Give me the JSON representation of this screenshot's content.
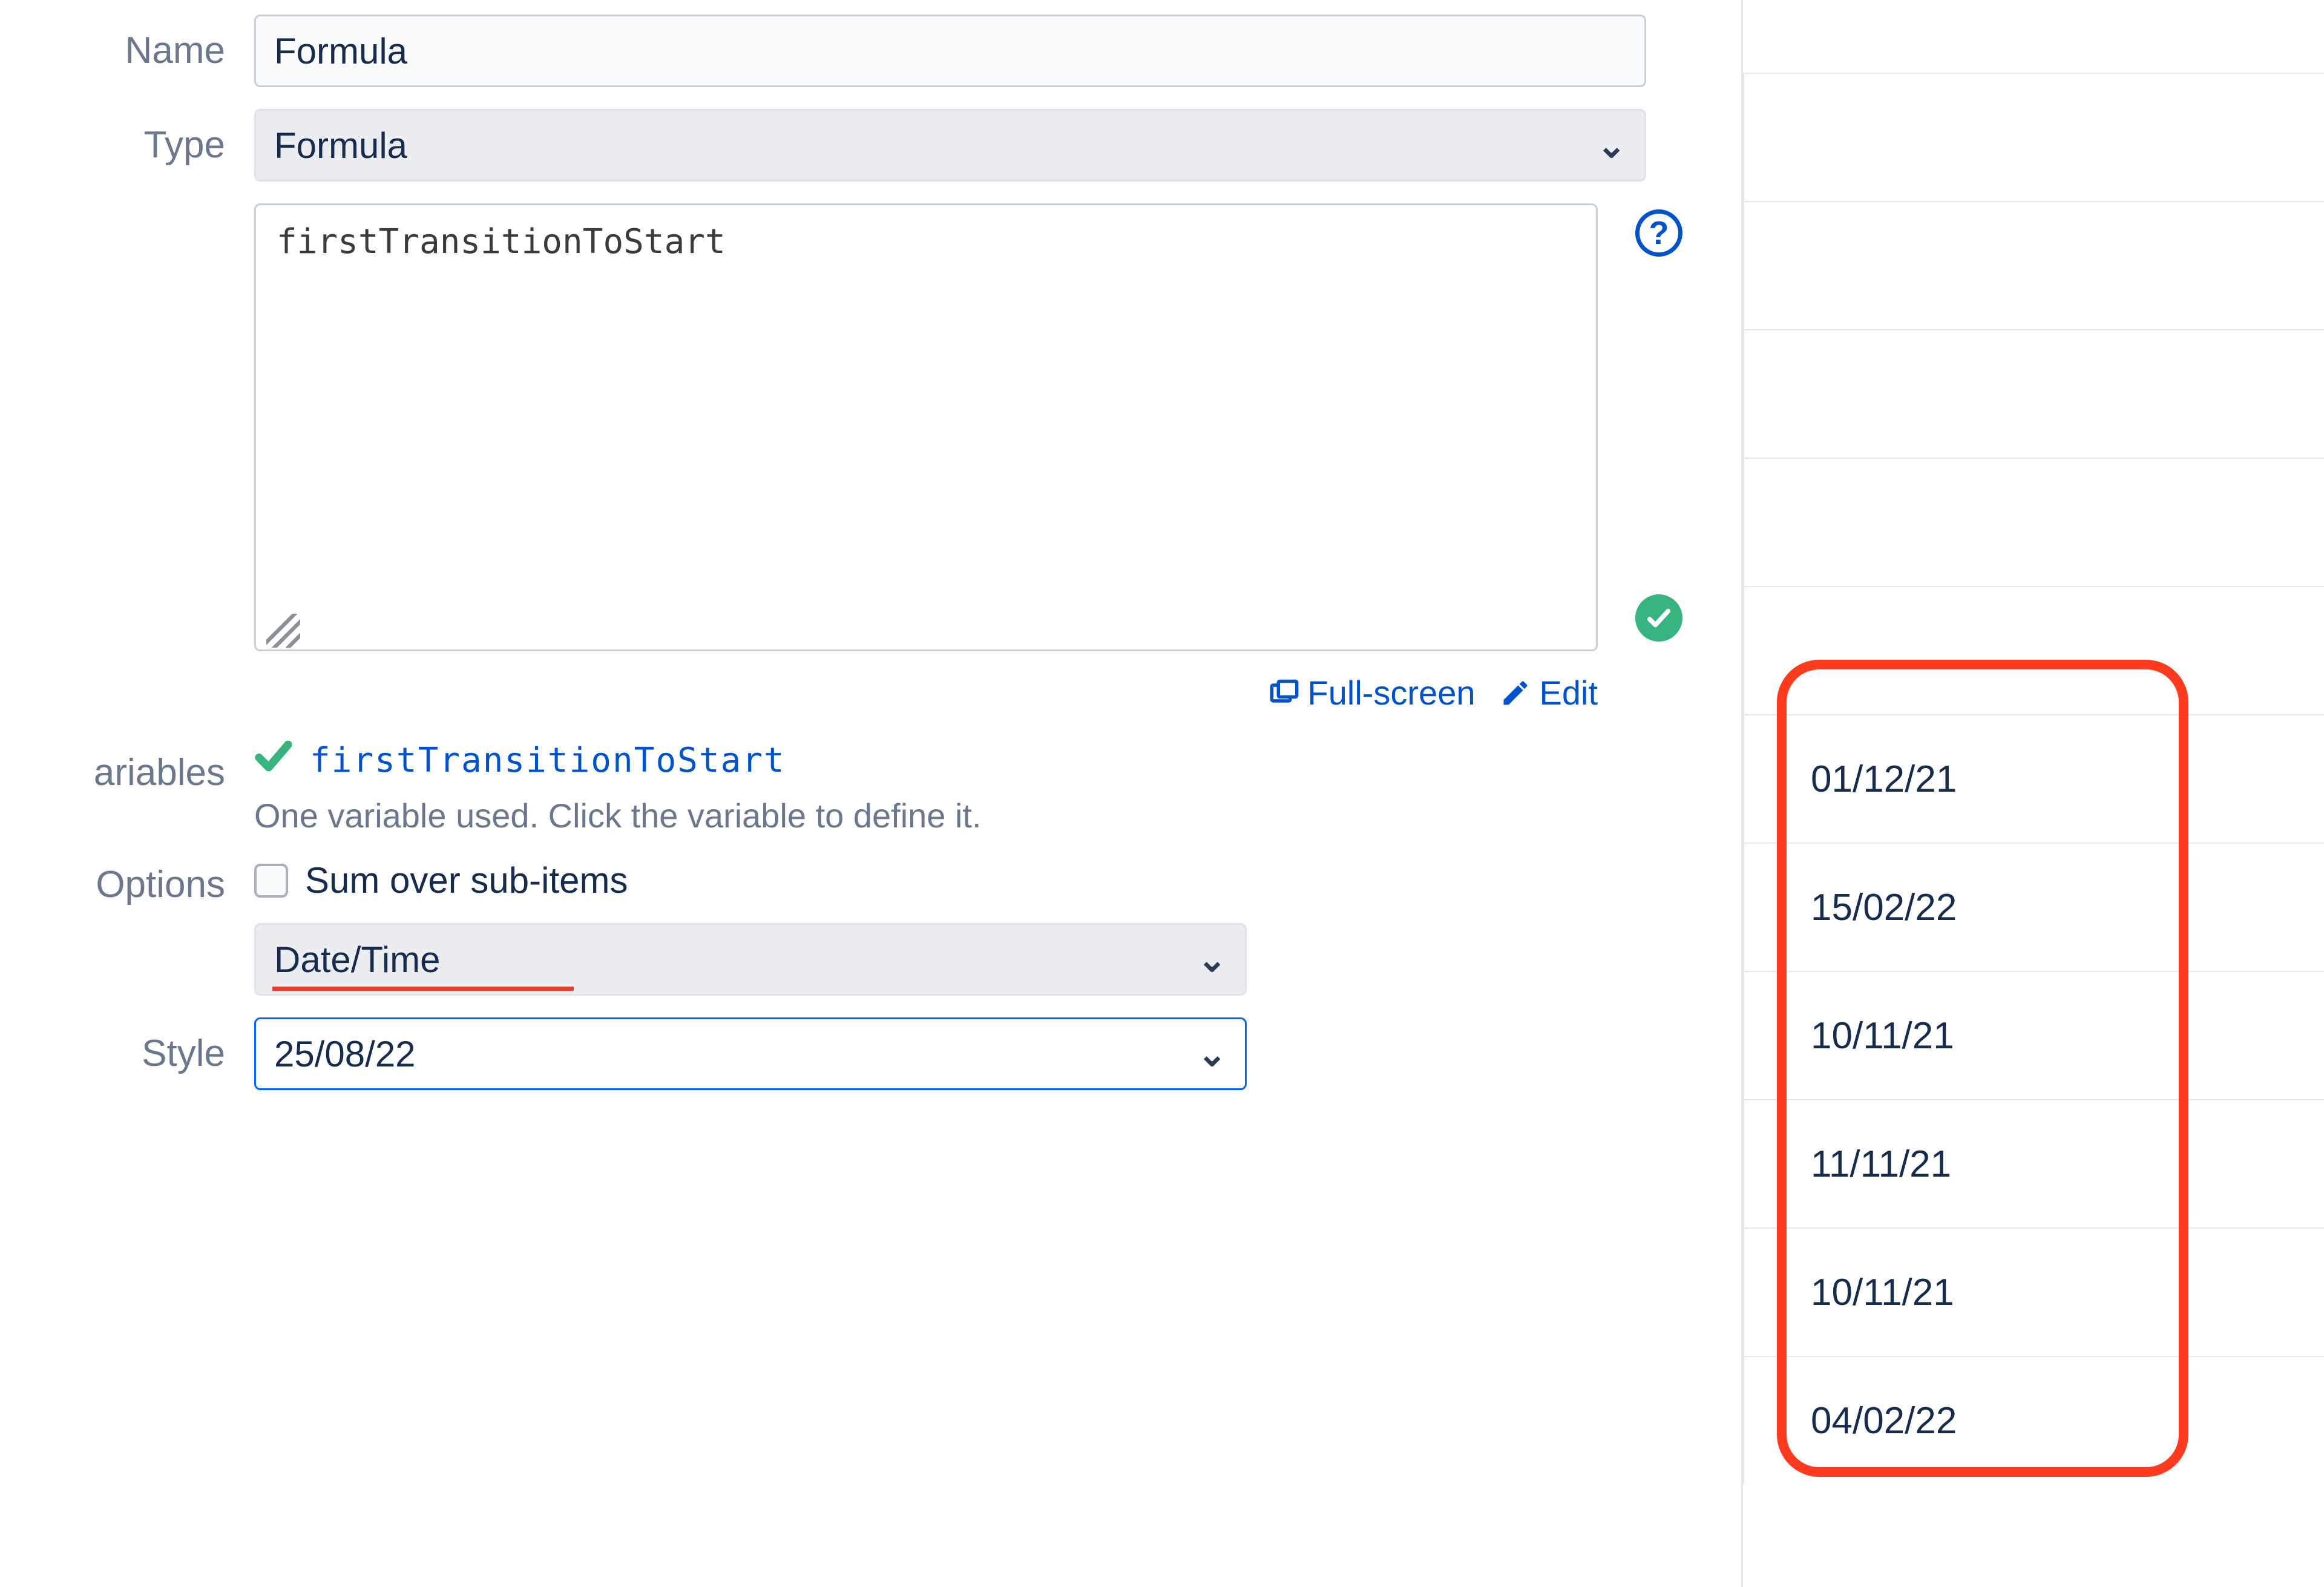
{
  "labels": {
    "name": "Name",
    "type": "Type",
    "variables": "ariables",
    "options": "Options",
    "style": "Style"
  },
  "fields": {
    "name_value": "Formula",
    "type_value": "Formula",
    "formula_code": "firstTransitionToStart",
    "fullscreen": "Full-screen",
    "edit": "Edit",
    "variable_name": "firstTransitionToStart",
    "variable_hint": "One variable used. Click the variable to define it.",
    "sum_checkbox_label": "Sum over sub-items",
    "format_select": "Date/Time",
    "style_select": "25/08/22"
  },
  "results": [
    "",
    "",
    "",
    "",
    "",
    "01/12/21",
    "15/02/22",
    "10/11/21",
    "11/11/21",
    "10/11/21",
    "04/02/22"
  ]
}
